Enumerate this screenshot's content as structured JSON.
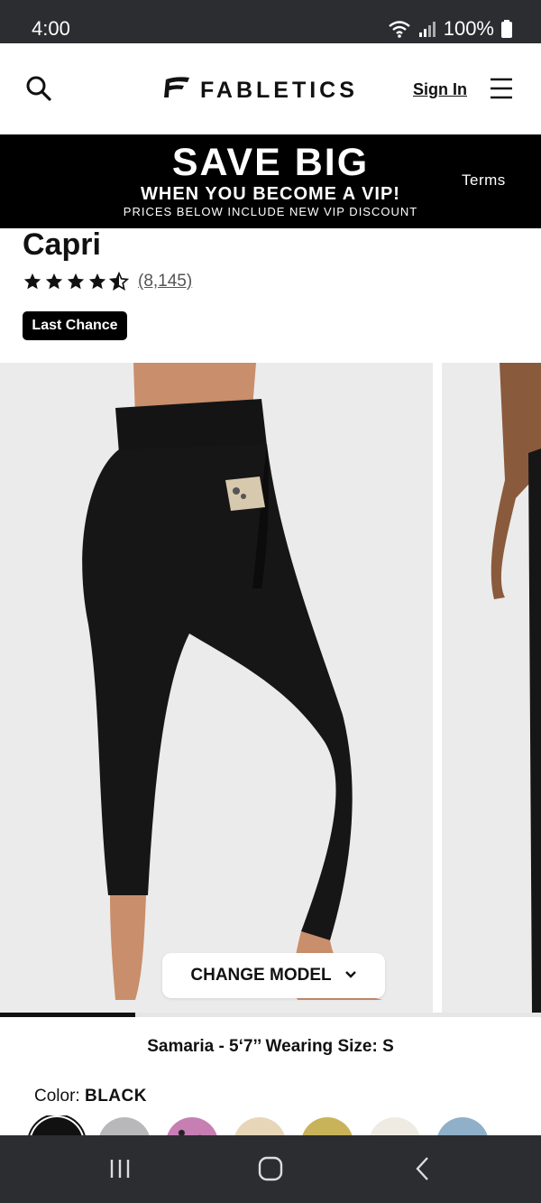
{
  "status_bar": {
    "time": "4:00",
    "battery": "100%"
  },
  "header": {
    "logo_text": "FABLETICS",
    "sign_in_label": "Sign In",
    "icons": {
      "search": "search-icon",
      "menu": "hamburger-menu-icon",
      "logo": "fabletics-logo-icon"
    }
  },
  "banner": {
    "headline": "SAVE BIG",
    "subheadline": "WHEN YOU BECOME A VIP!",
    "note": "PRICES BELOW INCLUDE NEW VIP DISCOUNT",
    "terms_label": "Terms"
  },
  "product": {
    "title": "Capri",
    "rating": 4.5,
    "review_count": "(8,145)",
    "badge": "Last Chance"
  },
  "gallery": {
    "change_model_label": "CHANGE MODEL",
    "progress_fraction": 0.25
  },
  "model_info": "Samaria - 5‘7’’ Wearing Size: S",
  "color": {
    "label": "Color:",
    "selected": "BLACK",
    "swatches": [
      "#111111",
      "#b8b8ba",
      "#c77fb3",
      "#e7d6b8",
      "#c9b35a",
      "#efebe3",
      "#8fb0c8"
    ]
  },
  "nav_bar": {
    "icons": [
      "recent-apps-icon",
      "home-icon",
      "back-icon"
    ]
  }
}
